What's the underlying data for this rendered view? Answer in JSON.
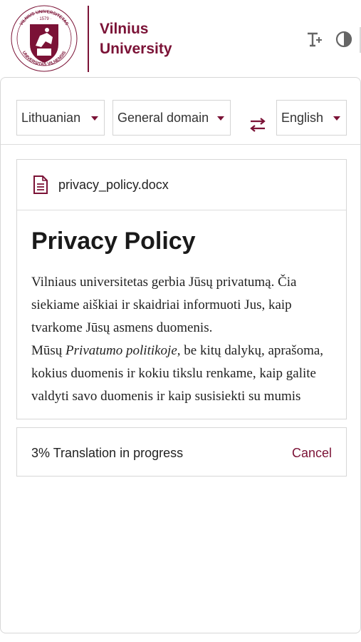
{
  "header": {
    "brand_line1": "Vilnius",
    "brand_line2": "University",
    "seal": {
      "ring_text": "VILNIUS UNIVERSITETAS · UNIVERSITAS VILNENSIS",
      "year": "1579"
    },
    "icons": [
      "text-size-icon",
      "contrast-icon"
    ]
  },
  "toolbar": {
    "source_language": "Lithuanian",
    "domain": "General domain",
    "target_language": "English"
  },
  "document": {
    "file_name": "privacy_policy.docx",
    "title": "Privacy Policy",
    "paragraph1": "Vilniaus universitetas gerbia Jūsų privatumą. Čia siekiame aiškiai ir skaidriai informuoti Jus, kaip tvarkome Jūsų asmens duomenis.",
    "paragraph2_before": "Mūsų ",
    "paragraph2_italic": "Privatumo politikoje",
    "paragraph2_after": ", be kitų dalykų, aprašoma, kokius duomenis ir kokiu tikslu renkame, kaip galite valdyti savo duomenis ir kaip",
    "paragraph2_cut": "susisiekti su mumis"
  },
  "progress": {
    "status": "3% Translation in progress",
    "percent": 3,
    "cancel_label": "Cancel"
  },
  "colors": {
    "brand": "#7b1236",
    "border": "#d7d7d7"
  }
}
